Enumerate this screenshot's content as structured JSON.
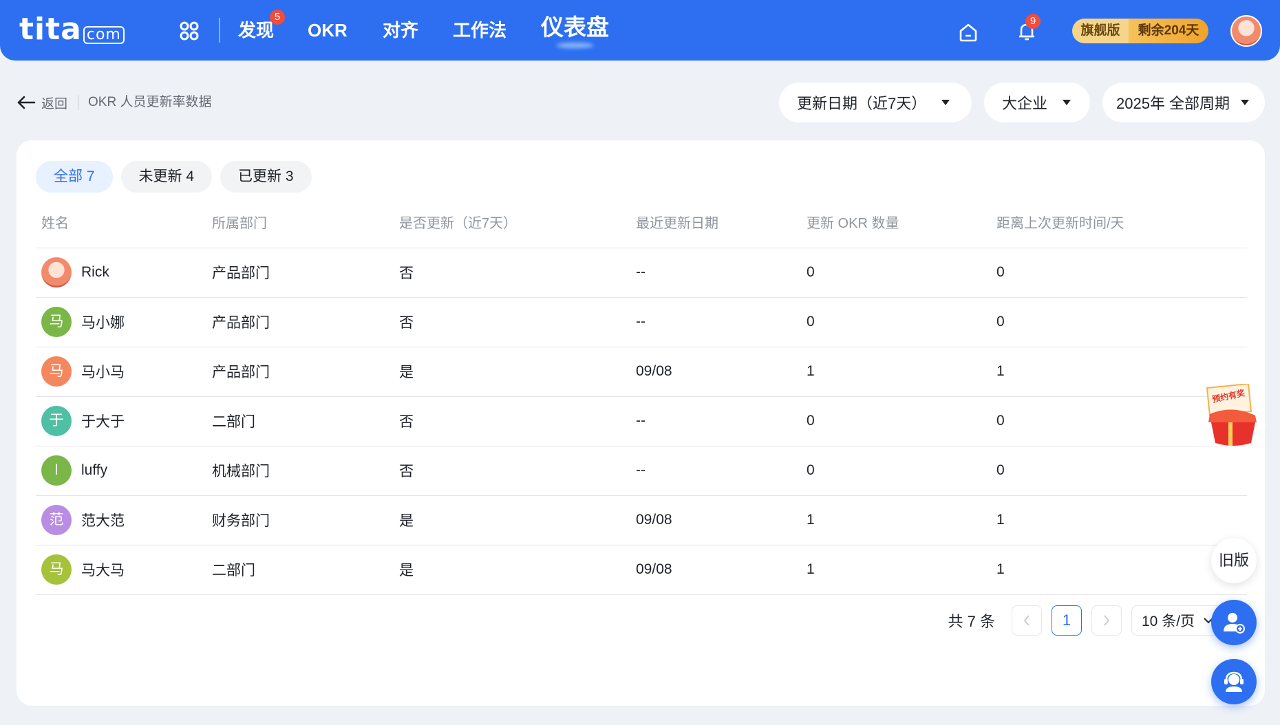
{
  "nav": {
    "logo_text": "tita",
    "logo_suffix": "com",
    "items": [
      {
        "label": "发现",
        "badge": "5"
      },
      {
        "label": "OKR"
      },
      {
        "label": "对齐"
      },
      {
        "label": "工作法"
      },
      {
        "label": "仪表盘",
        "active": true
      }
    ],
    "notification_badge": "9",
    "edition": {
      "name": "旗舰版",
      "remaining": "剩余204天"
    }
  },
  "header": {
    "back_label": "返回",
    "page_title": "OKR 人员更新率数据",
    "filters": [
      "更新日期（近7天）",
      "大企业",
      "2025年 全部周期"
    ]
  },
  "tabs": [
    {
      "label": "全部 7",
      "active": true
    },
    {
      "label": "未更新 4"
    },
    {
      "label": "已更新 3"
    }
  ],
  "table": {
    "columns": [
      "姓名",
      "所属部门",
      "是否更新（近7天）",
      "最近更新日期",
      "更新 OKR 数量",
      "距离上次更新时间/天"
    ],
    "rows": [
      {
        "avatar": "",
        "avatar_color": "",
        "name": "Rick",
        "dept": "产品部门",
        "updated": "否",
        "date": "--",
        "count": "0",
        "days": "0"
      },
      {
        "avatar": "马",
        "avatar_color": "#7ab648",
        "name": "马小娜",
        "dept": "产品部门",
        "updated": "否",
        "date": "--",
        "count": "0",
        "days": "0"
      },
      {
        "avatar": "马",
        "avatar_color": "#f4875e",
        "name": "马小马",
        "dept": "产品部门",
        "updated": "是",
        "date": "09/08",
        "count": "1",
        "days": "1"
      },
      {
        "avatar": "于",
        "avatar_color": "#4fc0a4",
        "name": "于大于",
        "dept": "二部门",
        "updated": "否",
        "date": "--",
        "count": "0",
        "days": "0"
      },
      {
        "avatar": "l",
        "avatar_color": "#7ab648",
        "name": "luffy",
        "dept": "机械部门",
        "updated": "否",
        "date": "--",
        "count": "0",
        "days": "0"
      },
      {
        "avatar": "范",
        "avatar_color": "#b88de3",
        "name": "范大范",
        "dept": "财务部门",
        "updated": "是",
        "date": "09/08",
        "count": "1",
        "days": "1"
      },
      {
        "avatar": "马",
        "avatar_color": "#a6c23a",
        "name": "马大马",
        "dept": "二部门",
        "updated": "是",
        "date": "09/08",
        "count": "1",
        "days": "1"
      }
    ]
  },
  "pagination": {
    "total": "共 7 条",
    "current": "1",
    "page_size": "10 条/页"
  },
  "widgets": {
    "old_version": "旧版",
    "promo_text": "预约有奖"
  },
  "colors": {
    "primary": "#2d6ff0",
    "background": "#eef1f6"
  }
}
